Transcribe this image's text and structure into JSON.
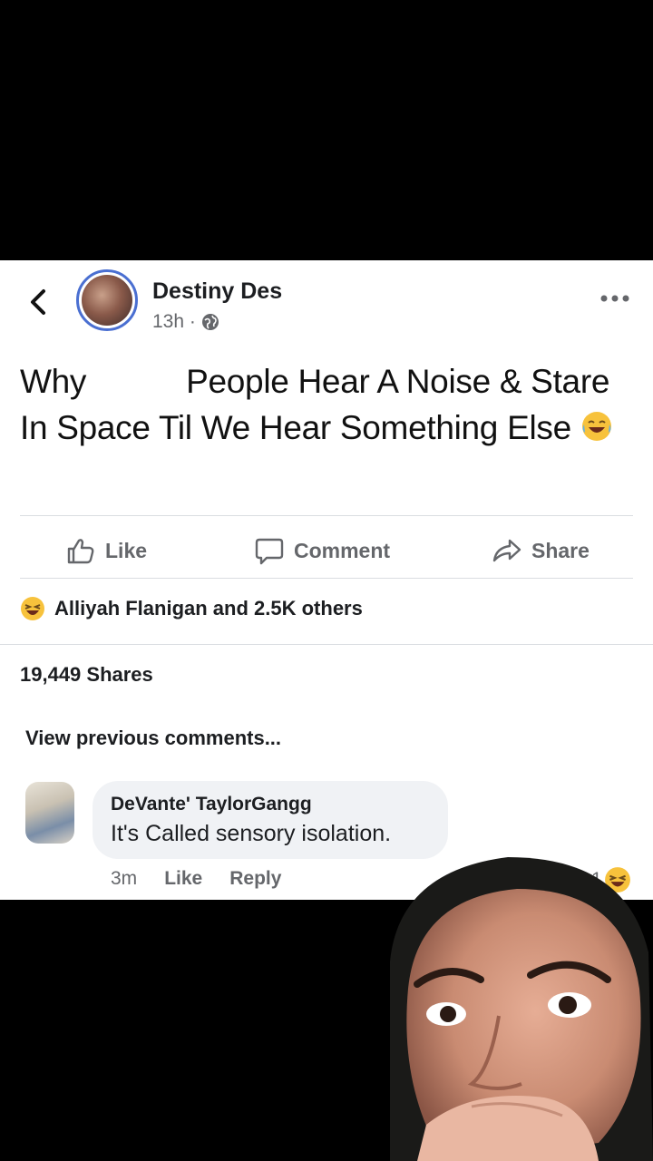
{
  "post": {
    "author": "Destiny Des",
    "time": "13h · ",
    "text_part1": "Why",
    "text_part2": "People Hear A Noise & Stare In Space Til We Hear Something Else"
  },
  "actions": {
    "like": "Like",
    "comment": "Comment",
    "share": "Share"
  },
  "reactions": {
    "summary": "Alliyah Flanigan and 2.5K others"
  },
  "shares": "19,449 Shares",
  "view_previous": "View previous comments...",
  "comment": {
    "author": "DeVante' TaylorGangg",
    "text": "It's Called sensory isolation.",
    "time": "3m",
    "like": "Like",
    "reply": "Reply",
    "reaction_count": "1"
  },
  "colors": {
    "accent": "#4a6fd1",
    "muted": "#65676b",
    "bubble": "#f0f2f5"
  }
}
